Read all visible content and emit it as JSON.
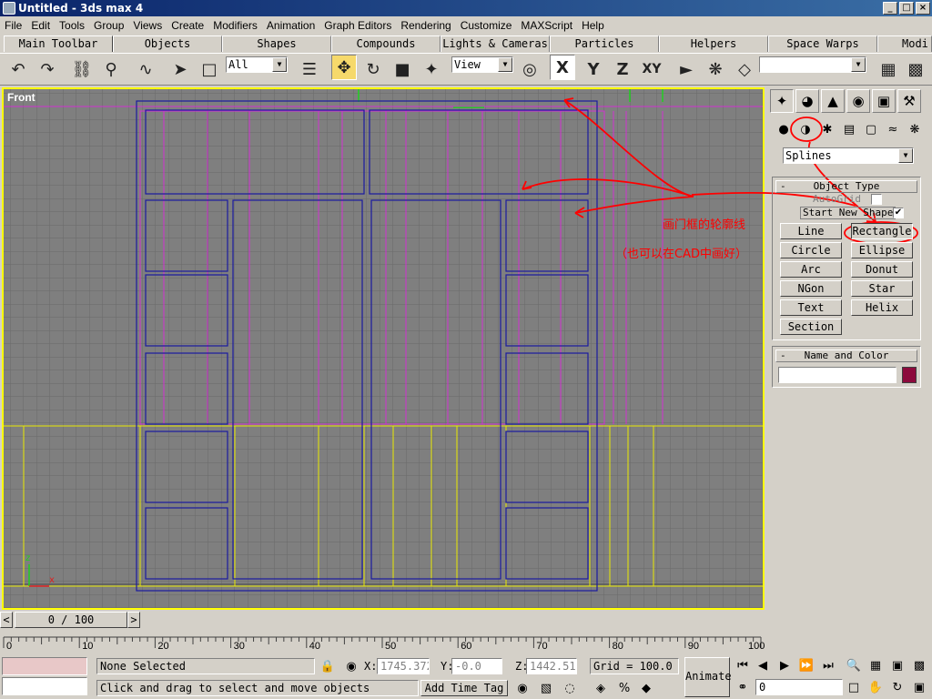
{
  "window": {
    "title": "Untitled - 3ds max 4",
    "buttons": [
      "_",
      "□",
      "×"
    ]
  },
  "menu": [
    "File",
    "Edit",
    "Tools",
    "Group",
    "Views",
    "Create",
    "Modifiers",
    "Animation",
    "Graph Editors",
    "Rendering",
    "Customize",
    "MAXScript",
    "Help"
  ],
  "tabs": [
    "Main Toolbar",
    "Objects",
    "Shapes",
    "Compounds",
    "Lights & Cameras",
    "Particles",
    "Helpers",
    "Space Warps",
    "Modi"
  ],
  "toolbar": {
    "selection_filter": "All",
    "reference_coord": "View",
    "axis_x": "X",
    "axis_y": "Y",
    "axis_z": "Z",
    "axis_xy": "XY",
    "named_selection": ""
  },
  "viewport": {
    "label": "Front",
    "axis_z": "z",
    "axis_x": "x"
  },
  "annotations": {
    "line1": "画门框的轮廓线",
    "line2": "（也可以在CAD中画好）"
  },
  "command_panel": {
    "category": "Splines",
    "object_type_title": "Object Type",
    "autogrid": "AutoGrid",
    "start_new_shape": "Start New Shape",
    "start_new_shape_checked": "✔",
    "buttons": [
      "Line",
      "Rectangle",
      "Circle",
      "Ellipse",
      "Arc",
      "Donut",
      "NGon",
      "Star",
      "Text",
      "Helix",
      "Section"
    ],
    "name_color_title": "Name and Color",
    "object_name": "",
    "object_color": "#8c0a3c",
    "rollout_minus": "-"
  },
  "timeline": {
    "slider_label": "0 / 100",
    "ticks": [
      "0",
      "10",
      "20",
      "30",
      "40",
      "50",
      "60",
      "70",
      "80",
      "90",
      "100"
    ]
  },
  "status": {
    "selection": "None Selected",
    "prompt": "Click and drag to select and move objects",
    "x_label": "X:",
    "x_value": "1745.372",
    "y_label": "Y:",
    "y_value": "-0.0",
    "z_label": "Z:",
    "z_value": "1442.51",
    "grid": "Grid = 100.0",
    "add_time_tag": "Add Time Tag",
    "animate": "Animate",
    "frame": "0"
  }
}
